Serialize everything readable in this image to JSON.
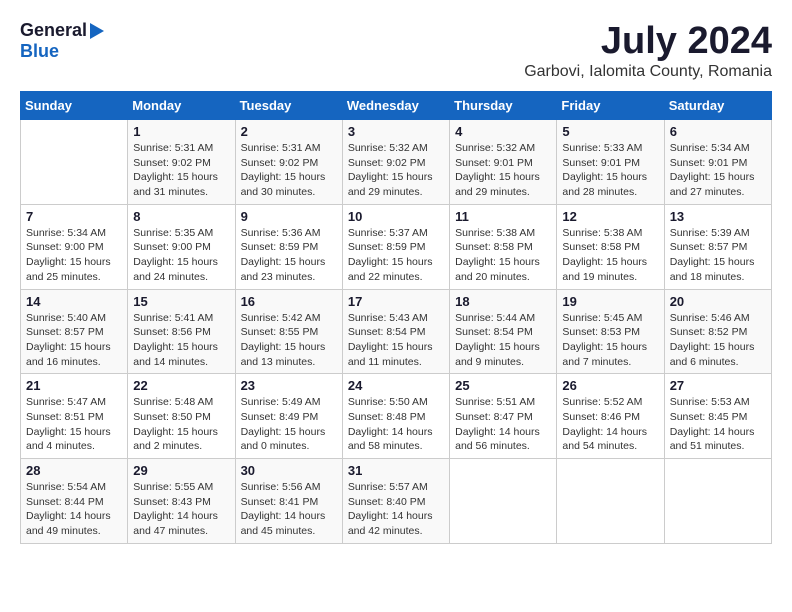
{
  "logo": {
    "general": "General",
    "blue": "Blue"
  },
  "title": "July 2024",
  "subtitle": "Garbovi, Ialomita County, Romania",
  "headers": [
    "Sunday",
    "Monday",
    "Tuesday",
    "Wednesday",
    "Thursday",
    "Friday",
    "Saturday"
  ],
  "weeks": [
    [
      {
        "day": "",
        "info": ""
      },
      {
        "day": "1",
        "info": "Sunrise: 5:31 AM\nSunset: 9:02 PM\nDaylight: 15 hours\nand 31 minutes."
      },
      {
        "day": "2",
        "info": "Sunrise: 5:31 AM\nSunset: 9:02 PM\nDaylight: 15 hours\nand 30 minutes."
      },
      {
        "day": "3",
        "info": "Sunrise: 5:32 AM\nSunset: 9:02 PM\nDaylight: 15 hours\nand 29 minutes."
      },
      {
        "day": "4",
        "info": "Sunrise: 5:32 AM\nSunset: 9:01 PM\nDaylight: 15 hours\nand 29 minutes."
      },
      {
        "day": "5",
        "info": "Sunrise: 5:33 AM\nSunset: 9:01 PM\nDaylight: 15 hours\nand 28 minutes."
      },
      {
        "day": "6",
        "info": "Sunrise: 5:34 AM\nSunset: 9:01 PM\nDaylight: 15 hours\nand 27 minutes."
      }
    ],
    [
      {
        "day": "7",
        "info": "Sunrise: 5:34 AM\nSunset: 9:00 PM\nDaylight: 15 hours\nand 25 minutes."
      },
      {
        "day": "8",
        "info": "Sunrise: 5:35 AM\nSunset: 9:00 PM\nDaylight: 15 hours\nand 24 minutes."
      },
      {
        "day": "9",
        "info": "Sunrise: 5:36 AM\nSunset: 8:59 PM\nDaylight: 15 hours\nand 23 minutes."
      },
      {
        "day": "10",
        "info": "Sunrise: 5:37 AM\nSunset: 8:59 PM\nDaylight: 15 hours\nand 22 minutes."
      },
      {
        "day": "11",
        "info": "Sunrise: 5:38 AM\nSunset: 8:58 PM\nDaylight: 15 hours\nand 20 minutes."
      },
      {
        "day": "12",
        "info": "Sunrise: 5:38 AM\nSunset: 8:58 PM\nDaylight: 15 hours\nand 19 minutes."
      },
      {
        "day": "13",
        "info": "Sunrise: 5:39 AM\nSunset: 8:57 PM\nDaylight: 15 hours\nand 18 minutes."
      }
    ],
    [
      {
        "day": "14",
        "info": "Sunrise: 5:40 AM\nSunset: 8:57 PM\nDaylight: 15 hours\nand 16 minutes."
      },
      {
        "day": "15",
        "info": "Sunrise: 5:41 AM\nSunset: 8:56 PM\nDaylight: 15 hours\nand 14 minutes."
      },
      {
        "day": "16",
        "info": "Sunrise: 5:42 AM\nSunset: 8:55 PM\nDaylight: 15 hours\nand 13 minutes."
      },
      {
        "day": "17",
        "info": "Sunrise: 5:43 AM\nSunset: 8:54 PM\nDaylight: 15 hours\nand 11 minutes."
      },
      {
        "day": "18",
        "info": "Sunrise: 5:44 AM\nSunset: 8:54 PM\nDaylight: 15 hours\nand 9 minutes."
      },
      {
        "day": "19",
        "info": "Sunrise: 5:45 AM\nSunset: 8:53 PM\nDaylight: 15 hours\nand 7 minutes."
      },
      {
        "day": "20",
        "info": "Sunrise: 5:46 AM\nSunset: 8:52 PM\nDaylight: 15 hours\nand 6 minutes."
      }
    ],
    [
      {
        "day": "21",
        "info": "Sunrise: 5:47 AM\nSunset: 8:51 PM\nDaylight: 15 hours\nand 4 minutes."
      },
      {
        "day": "22",
        "info": "Sunrise: 5:48 AM\nSunset: 8:50 PM\nDaylight: 15 hours\nand 2 minutes."
      },
      {
        "day": "23",
        "info": "Sunrise: 5:49 AM\nSunset: 8:49 PM\nDaylight: 15 hours\nand 0 minutes."
      },
      {
        "day": "24",
        "info": "Sunrise: 5:50 AM\nSunset: 8:48 PM\nDaylight: 14 hours\nand 58 minutes."
      },
      {
        "day": "25",
        "info": "Sunrise: 5:51 AM\nSunset: 8:47 PM\nDaylight: 14 hours\nand 56 minutes."
      },
      {
        "day": "26",
        "info": "Sunrise: 5:52 AM\nSunset: 8:46 PM\nDaylight: 14 hours\nand 54 minutes."
      },
      {
        "day": "27",
        "info": "Sunrise: 5:53 AM\nSunset: 8:45 PM\nDaylight: 14 hours\nand 51 minutes."
      }
    ],
    [
      {
        "day": "28",
        "info": "Sunrise: 5:54 AM\nSunset: 8:44 PM\nDaylight: 14 hours\nand 49 minutes."
      },
      {
        "day": "29",
        "info": "Sunrise: 5:55 AM\nSunset: 8:43 PM\nDaylight: 14 hours\nand 47 minutes."
      },
      {
        "day": "30",
        "info": "Sunrise: 5:56 AM\nSunset: 8:41 PM\nDaylight: 14 hours\nand 45 minutes."
      },
      {
        "day": "31",
        "info": "Sunrise: 5:57 AM\nSunset: 8:40 PM\nDaylight: 14 hours\nand 42 minutes."
      },
      {
        "day": "",
        "info": ""
      },
      {
        "day": "",
        "info": ""
      },
      {
        "day": "",
        "info": ""
      }
    ]
  ]
}
